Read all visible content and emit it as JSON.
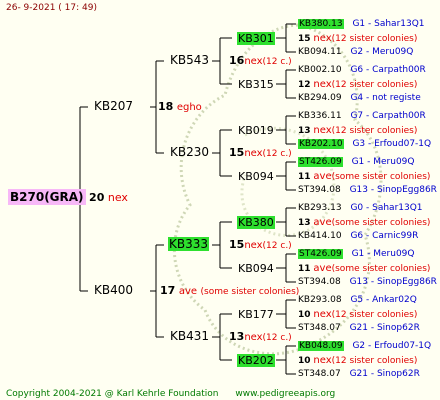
{
  "date": "26-  9-2021  ( 17:  49)",
  "root": {
    "name": "B270(GRA)",
    "num": "20",
    "note": "nex"
  },
  "gen1": [
    {
      "name": "KB207",
      "num": "18",
      "note": "egho"
    },
    {
      "name": "KB400",
      "num": "17",
      "note": "ave",
      "extra": "(some sister colonies)"
    }
  ],
  "gen2": [
    {
      "name": "KB543",
      "num": "16",
      "note": "nex",
      "extra": "(12 c.)"
    },
    {
      "name": "KB230",
      "num": "15",
      "note": "nex",
      "extra": "(12 c.)"
    },
    {
      "name": "KB333",
      "num": "15",
      "note": "nex",
      "extra": "(12 c.)"
    },
    {
      "name": "KB431",
      "num": "13",
      "note": "nex",
      "extra": "(12 c.)"
    }
  ],
  "gen3": [
    {
      "name": "KB301"
    },
    {
      "name": "KB315"
    },
    {
      "name": "KB019"
    },
    {
      "name": "KB094"
    },
    {
      "name": "KB380"
    },
    {
      "name": "KB094"
    },
    {
      "name": "KB177"
    },
    {
      "name": "KB202"
    }
  ],
  "gen4": [
    {
      "top": "KB380.13",
      "tinfo": "G1 - Sahar13Q1",
      "num": "15",
      "note": "nex",
      "extra": "(12 sister colonies)",
      "bot": "KB094.11",
      "binfo": "G2 - Meru09Q"
    },
    {
      "top": "KB002.10",
      "tinfo": "G6 - Carpath00R",
      "num": "12",
      "note": "nex",
      "extra": "(12 sister colonies)",
      "bot": "KB294.09",
      "binfo": "G4 - not registe"
    },
    {
      "top": "KB336.11",
      "tinfo": "G7 - Carpath00R",
      "num": "13",
      "note": "nex",
      "extra": "(12 sister colonies)",
      "bot": "KB202.10",
      "binfo": "G3 - Erfoud07-1Q"
    },
    {
      "top": "ST426.09",
      "tinfo": "G1 - Meru09Q",
      "num": "11",
      "note": "ave",
      "extra": "(some sister colonies)",
      "bot": "ST394.08",
      "binfo": "G13 - SinopEgg86R"
    },
    {
      "top": "KB293.13",
      "tinfo": "G0 - Sahar13Q1",
      "num": "13",
      "note": "ave",
      "extra": "(some sister colonies)",
      "bot": "KB414.10",
      "binfo": "G6 - Carnic99R"
    },
    {
      "top": "ST426.09",
      "tinfo": "G1 - Meru09Q",
      "num": "11",
      "note": "ave",
      "extra": "(some sister colonies)",
      "bot": "ST394.08",
      "binfo": "G13 - SinopEgg86R"
    },
    {
      "top": "KB293.08",
      "tinfo": "G5 - Ankar02Q",
      "num": "10",
      "note": "nex",
      "extra": "(12 sister colonies)",
      "bot": "ST348.07",
      "binfo": "G21 - Sinop62R"
    },
    {
      "top": "KB048.09",
      "tinfo": "G2 - Erfoud07-1Q",
      "num": "10",
      "note": "nex",
      "extra": "(12 sister colonies)",
      "bot": "ST348.07",
      "binfo": "G21 - Sinop62R"
    }
  ],
  "footer": {
    "copyright": "Copyright 2004-2021 @ Karl Kehrle Foundation",
    "url": "www.pedigreeapis.org"
  }
}
